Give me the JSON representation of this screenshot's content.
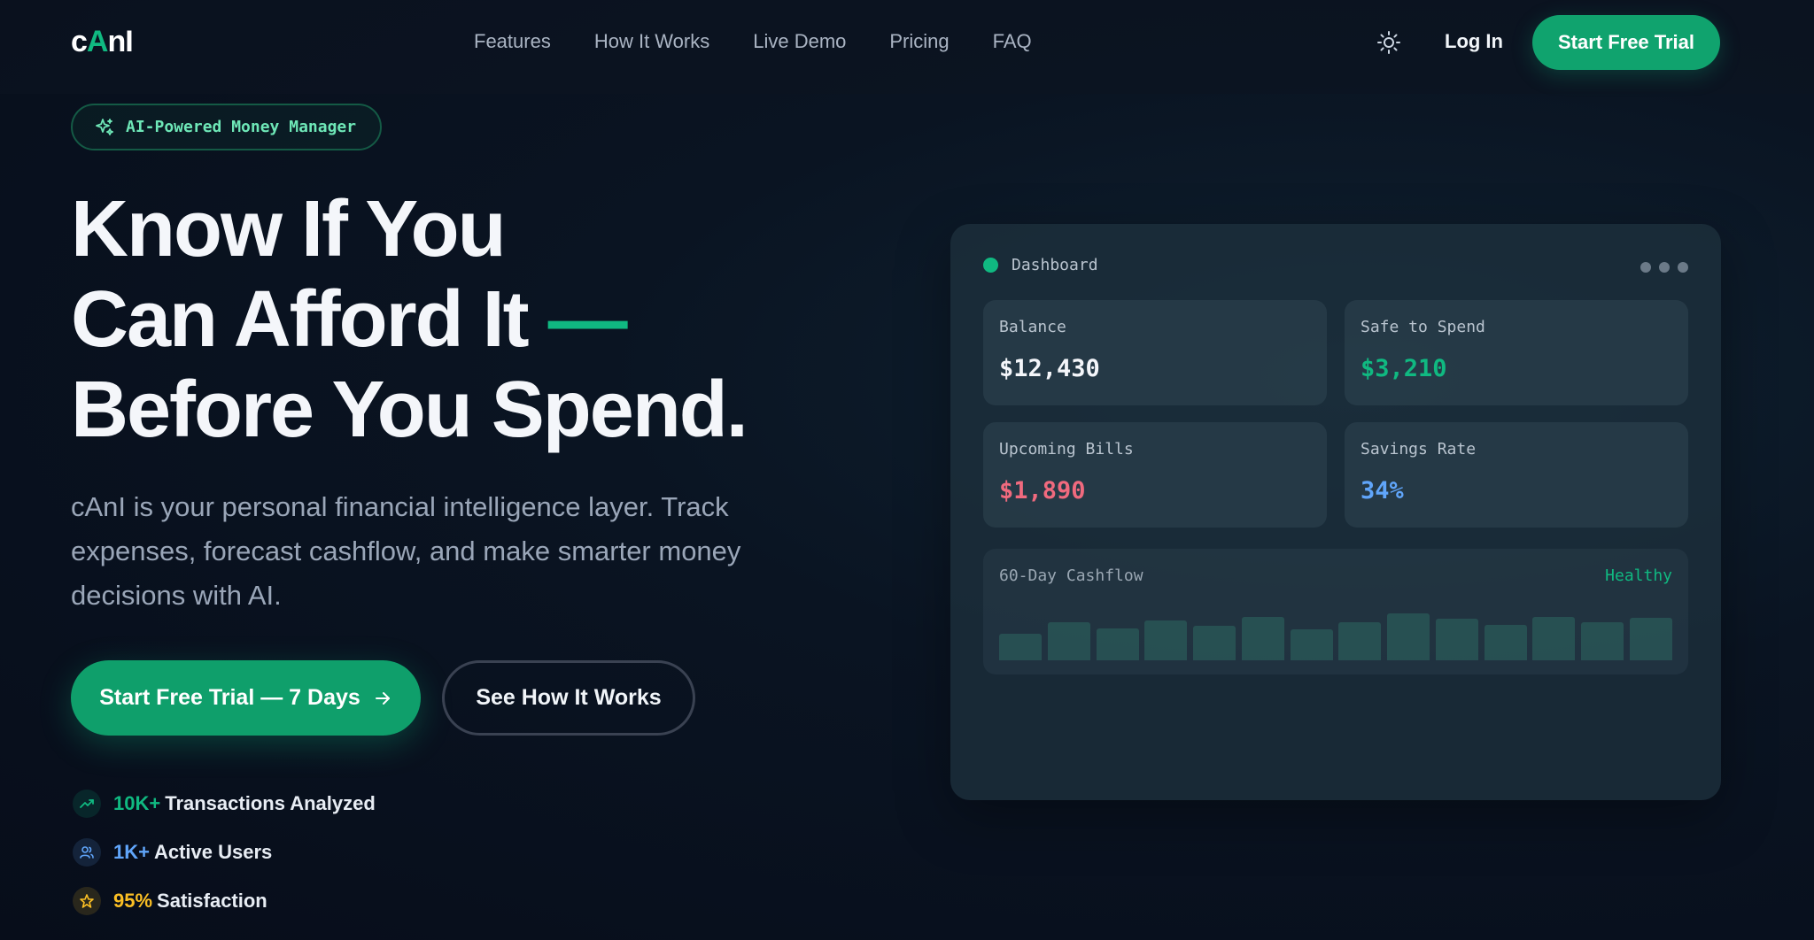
{
  "nav": {
    "logo_pre": "c",
    "logo_mid": "A",
    "logo_post": "nI",
    "links": [
      "Features",
      "How It Works",
      "Live Demo",
      "Pricing",
      "FAQ"
    ],
    "theme_icon": "sun-icon",
    "login": "Log In",
    "cta": "Start Free Trial"
  },
  "badge": {
    "icon": "sparkles-icon",
    "text": "AI-Powered Money Manager"
  },
  "hero": {
    "line1": "Know If You",
    "line2": "Can Afford It",
    "dash": "—",
    "line3": "Before You Spend.",
    "description": "cAnI is your personal financial intelligence layer. Track expenses, forecast cashflow, and make smarter money decisions with AI.",
    "primary_cta": "Start Free Trial — 7 Days",
    "secondary_cta": "See How It Works"
  },
  "stats": [
    {
      "value": "10K+",
      "label": "Transactions Analyzed",
      "icon": "trending-up-icon",
      "color": "#10b981"
    },
    {
      "value": "1K+",
      "label": "Active Users",
      "icon": "users-icon",
      "color": "#60a5fa"
    },
    {
      "value": "95%",
      "label": "Satisfaction",
      "icon": "star-icon",
      "color": "#fbbf24"
    }
  ],
  "dashboard": {
    "title": "Dashboard",
    "metrics": [
      {
        "label": "Balance",
        "value": "$12,430",
        "color": "#f4f6fa"
      },
      {
        "label": "Safe to Spend",
        "value": "$3,210",
        "color": "#10b981"
      },
      {
        "label": "Upcoming Bills",
        "value": "$1,890",
        "color": "#f06a7e"
      },
      {
        "label": "Savings Rate",
        "value": "34%",
        "color": "#60a5fa"
      }
    ],
    "cashflow": {
      "label": "60-Day Cashflow",
      "status": "Healthy",
      "levels": [
        0.5,
        0.72,
        0.6,
        0.75,
        0.65,
        0.82,
        0.58,
        0.72,
        0.88,
        0.78,
        0.66,
        0.82,
        0.72,
        0.8
      ]
    }
  }
}
